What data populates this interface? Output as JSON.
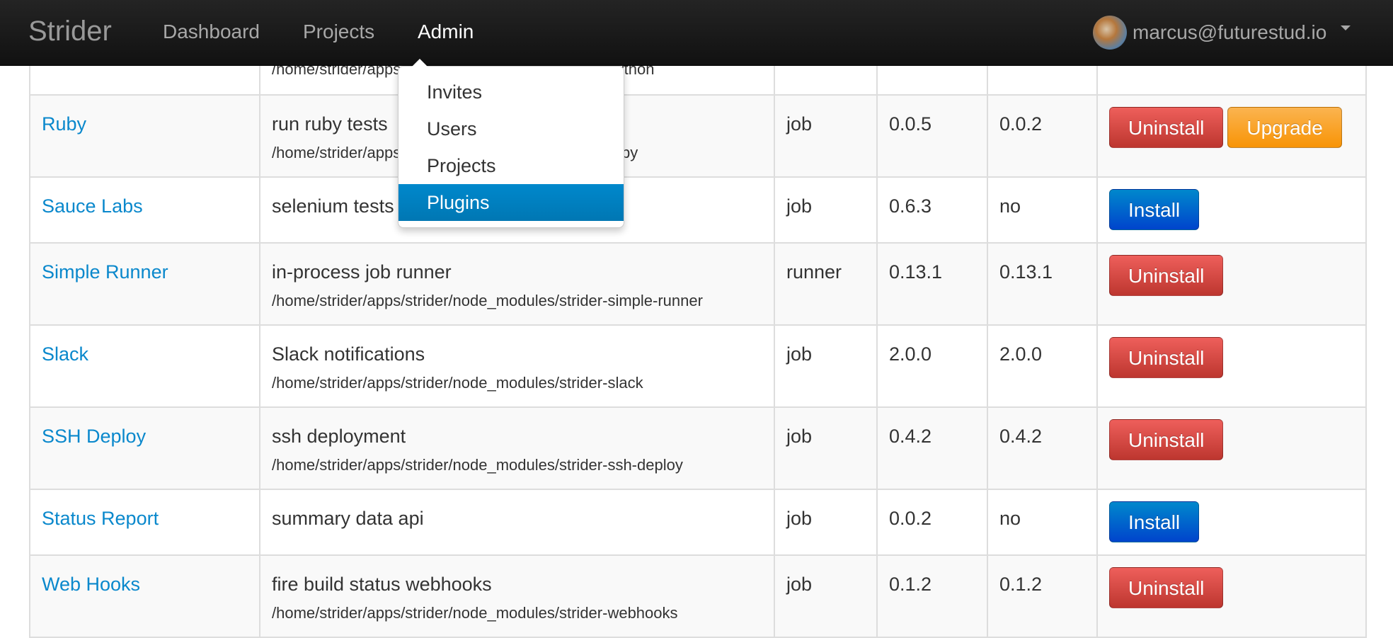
{
  "nav": {
    "brand": "Strider",
    "items": [
      "Dashboard",
      "Projects",
      "Admin"
    ],
    "active": "Admin",
    "user_email": "marcus@futurestud.io"
  },
  "admin_menu": {
    "items": [
      "Invites",
      "Users",
      "Projects",
      "Plugins"
    ],
    "active": "Plugins"
  },
  "table": {
    "rows": [
      {
        "name": "",
        "description": "",
        "path": "/home/strider/apps/strider/node_modules/strider-python",
        "type": "",
        "latest": "",
        "installed": "",
        "actions": []
      },
      {
        "name": "Ruby",
        "description": "run ruby tests",
        "path": "/home/strider/apps/strider/node_modules/strider-ruby",
        "type": "job",
        "latest": "0.0.5",
        "installed": "0.0.2",
        "actions": [
          "Uninstall",
          "Upgrade"
        ]
      },
      {
        "name": "Sauce Labs",
        "description": "selenium tests",
        "path": "",
        "type": "job",
        "latest": "0.6.3",
        "installed": "no",
        "actions": [
          "Install"
        ]
      },
      {
        "name": "Simple Runner",
        "description": "in-process job runner",
        "path": "/home/strider/apps/strider/node_modules/strider-simple-runner",
        "type": "runner",
        "latest": "0.13.1",
        "installed": "0.13.1",
        "actions": [
          "Uninstall"
        ]
      },
      {
        "name": "Slack",
        "description": "Slack notifications",
        "path": "/home/strider/apps/strider/node_modules/strider-slack",
        "type": "job",
        "latest": "2.0.0",
        "installed": "2.0.0",
        "actions": [
          "Uninstall"
        ]
      },
      {
        "name": "SSH Deploy",
        "description": "ssh deployment",
        "path": "/home/strider/apps/strider/node_modules/strider-ssh-deploy",
        "type": "job",
        "latest": "0.4.2",
        "installed": "0.4.2",
        "actions": [
          "Uninstall"
        ]
      },
      {
        "name": "Status Report",
        "description": "summary data api",
        "path": "",
        "type": "job",
        "latest": "0.0.2",
        "installed": "no",
        "actions": [
          "Install"
        ]
      },
      {
        "name": "Web Hooks",
        "description": "fire build status webhooks",
        "path": "/home/strider/apps/strider/node_modules/strider-webhooks",
        "type": "job",
        "latest": "0.1.2",
        "installed": "0.1.2",
        "actions": [
          "Uninstall"
        ]
      }
    ]
  },
  "colors": {
    "navbar": "#1b1b1b",
    "link": "#0a88cc",
    "danger": "#da4f49",
    "warning": "#faa732",
    "primary": "#006dcc",
    "menu_active": "#0081c2"
  }
}
